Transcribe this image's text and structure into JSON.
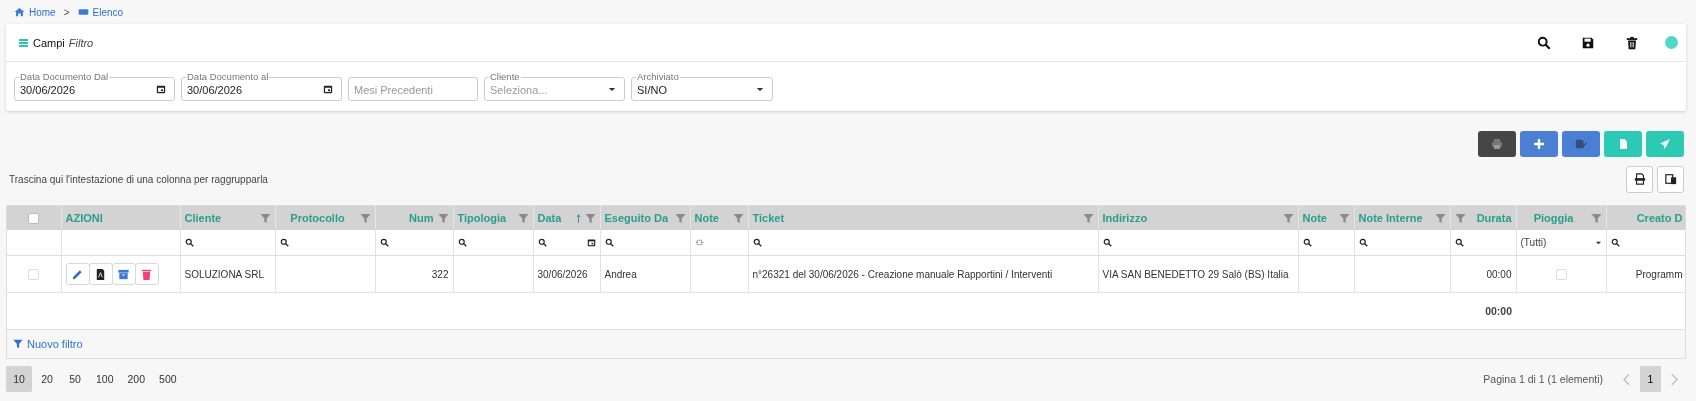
{
  "breadcrumb": [
    {
      "label": "Home"
    },
    {
      "label": "Elenco"
    }
  ],
  "breadcrumb_separator": ">",
  "filter_card": {
    "title": "Campi",
    "subtitle": "Filtro",
    "fields": [
      {
        "kind": "date",
        "label": "Data Documento Dal",
        "value": "30/06/2026"
      },
      {
        "kind": "date",
        "label": "Data Documento al",
        "value": "30/06/2026"
      },
      {
        "kind": "text",
        "placeholder": "Mesi Precedenti"
      },
      {
        "kind": "select",
        "label": "Cliente",
        "placeholder": "Seleziona..."
      },
      {
        "kind": "select",
        "label": "Archiviato",
        "value": "SI/NO"
      }
    ]
  },
  "group_hint": "Trascina qui l'intestazione di una colonna per raggrupparla",
  "table": {
    "select_all_checked": false,
    "columns": [
      {
        "label": "AZIONI",
        "sorted": false
      },
      {
        "label": "Cliente",
        "sorted": false
      },
      {
        "label": "Protocollo",
        "sorted": false
      },
      {
        "label": "Num",
        "sorted": false
      },
      {
        "label": "Tipologia",
        "sorted": false
      },
      {
        "label": "Data",
        "sorted": true
      },
      {
        "label": "Eseguito Da",
        "sorted": false
      },
      {
        "label": "Note",
        "sorted": false
      },
      {
        "label": "Ticket",
        "sorted": false
      },
      {
        "label": "Indirizzo",
        "sorted": false
      },
      {
        "label": "Note",
        "sorted": false
      },
      {
        "label": "Note Interne",
        "sorted": false
      },
      {
        "label": "Durata",
        "sorted": false
      },
      {
        "label": "Pioggia",
        "sorted": false,
        "filter_value": "(Tutti)"
      },
      {
        "label": "Creato D",
        "sorted": false
      }
    ],
    "rows": [
      {
        "checked": false,
        "cliente": "SOLUZIONA SRL",
        "num": "322",
        "data": "30/06/2026",
        "eseguito_da": "Andrea",
        "ticket": "n°26321 del 30/06/2026 - Creazione manuale Rapportini / Interventi",
        "indirizzo": "VIA SAN BENEDETTO 29 Salò (BS) Italia",
        "durata": "00:00",
        "pioggia_checked": false,
        "creato_da": "Programm"
      }
    ],
    "durata_total": "00:00",
    "new_filter": "Nuovo filtro"
  },
  "pager": {
    "sizes": [
      {
        "label": "10",
        "selected": true
      },
      {
        "label": "20",
        "selected": false
      },
      {
        "label": "50",
        "selected": false
      },
      {
        "label": "100",
        "selected": false
      },
      {
        "label": "200",
        "selected": false
      },
      {
        "label": "500",
        "selected": false
      }
    ],
    "info": "Pagina 1 di 1 (1 elementi)",
    "pages": [
      {
        "label": "1",
        "selected": true
      }
    ]
  }
}
